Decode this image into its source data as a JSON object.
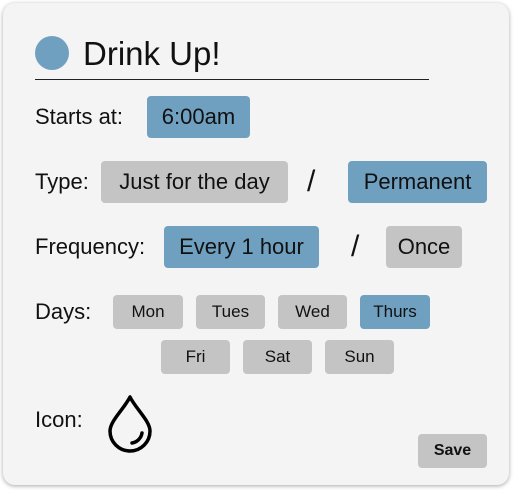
{
  "reminder": {
    "title": "Drink Up!",
    "color": "#6fa0c0"
  },
  "starts": {
    "label": "Starts at:",
    "time": "6:00am"
  },
  "type": {
    "label": "Type:",
    "options": [
      "Just for the day",
      "Permanent"
    ],
    "selected": "Permanent",
    "separator": "/"
  },
  "frequency": {
    "label": "Frequency:",
    "options": [
      "Every 1 hour",
      "Once"
    ],
    "selected": "Every 1 hour",
    "separator": "/"
  },
  "days": {
    "label": "Days:",
    "items": [
      "Mon",
      "Tues",
      "Wed",
      "Thurs",
      "Fri",
      "Sat",
      "Sun"
    ],
    "selected": [
      "Thurs"
    ]
  },
  "icon": {
    "label": "Icon:",
    "name": "water-drop-icon"
  },
  "actions": {
    "save_label": "Save"
  },
  "colors": {
    "accent": "#6fa0c0",
    "inactive": "#c4c4c4",
    "card": "#f4f4f4"
  }
}
